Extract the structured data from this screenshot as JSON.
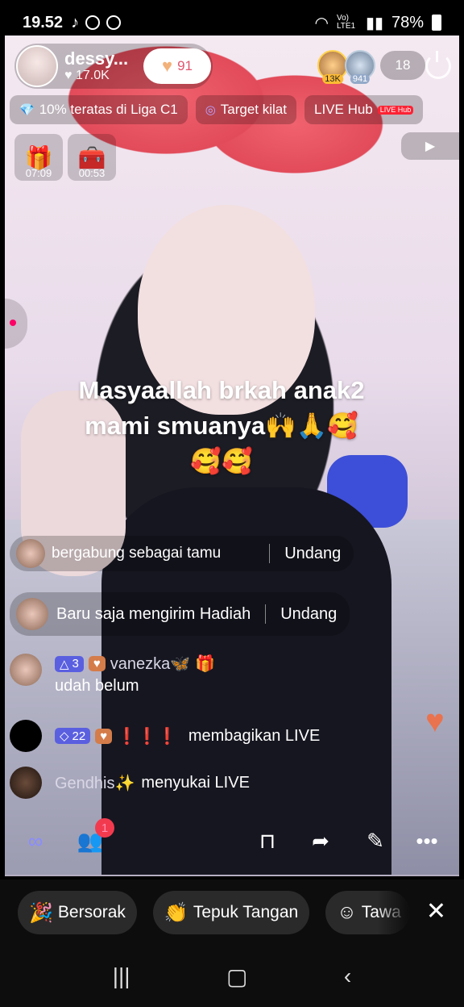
{
  "status_bar": {
    "time": "19.52",
    "notification_icons": [
      "tiktok-icon",
      "whatsapp-icon",
      "minus-circle-icon"
    ],
    "network": "Vo) LTE1",
    "battery": "78%"
  },
  "host": {
    "name": "dessy...",
    "likes": "17.0K",
    "like_count": "91"
  },
  "viewers": {
    "top1_badge": "13K",
    "top2_badge": "941",
    "count": "18"
  },
  "chips": [
    {
      "icon": "diamond-icon",
      "label": "10% teratas di Liga C1"
    },
    {
      "icon": "target-icon",
      "label": "Target kilat"
    },
    {
      "icon": "live-hub-icon",
      "label": "LIVE Hub",
      "badge": "LIVE Hub"
    }
  ],
  "gift_tiles": [
    {
      "icon": "gift-box-icon",
      "timer": "07:09"
    },
    {
      "icon": "treasure-chest-icon",
      "timer": "00:53"
    }
  ],
  "caption": {
    "line1": "Masyaallah brkah anak2",
    "line2": "mami smuanya🙌🙏🥰",
    "line3": "🥰🥰"
  },
  "comments": [
    {
      "type": "join",
      "name_partial": "...",
      "text": "bergabung sebagai tamu",
      "action": "Undang"
    },
    {
      "type": "gift",
      "text": "Baru saja mengirim Hadiah",
      "action": "Undang"
    },
    {
      "type": "chat",
      "level": "3",
      "name": "vanezka🦋",
      "text": "udah belum"
    },
    {
      "type": "share",
      "level": "22",
      "name": "❗❗❗",
      "text": "membagikan LIVE"
    },
    {
      "type": "like",
      "name": "Gendhis✨",
      "text": "menyukai LIVE"
    }
  ],
  "toolbar": {
    "guests_badge": "1"
  },
  "reactions": [
    {
      "icon": "cheer-icon",
      "label": "Bersorak"
    },
    {
      "icon": "clap-icon",
      "label": "Tepuk Tangan"
    },
    {
      "icon": "laugh-icon",
      "label": "Tawa"
    }
  ],
  "colors": {
    "accent": "#f23a4f",
    "level_badge": "#5a5fe0",
    "like_text": "#e0566f"
  }
}
